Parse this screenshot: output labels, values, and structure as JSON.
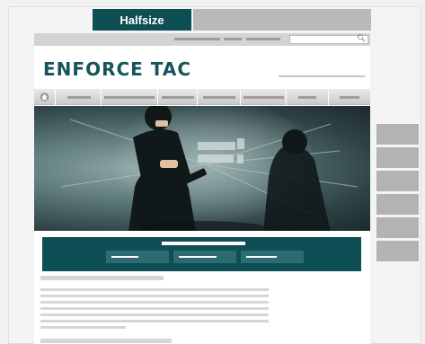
{
  "tabs": {
    "active_label": "Halfsize"
  },
  "site": {
    "logo_text": "ENFORCE TAC"
  },
  "icons": {
    "search": "search-icon",
    "home": "home-icon"
  },
  "colors": {
    "brand": "#0e4e55",
    "placeholder_bar": "#b9b9b9"
  }
}
